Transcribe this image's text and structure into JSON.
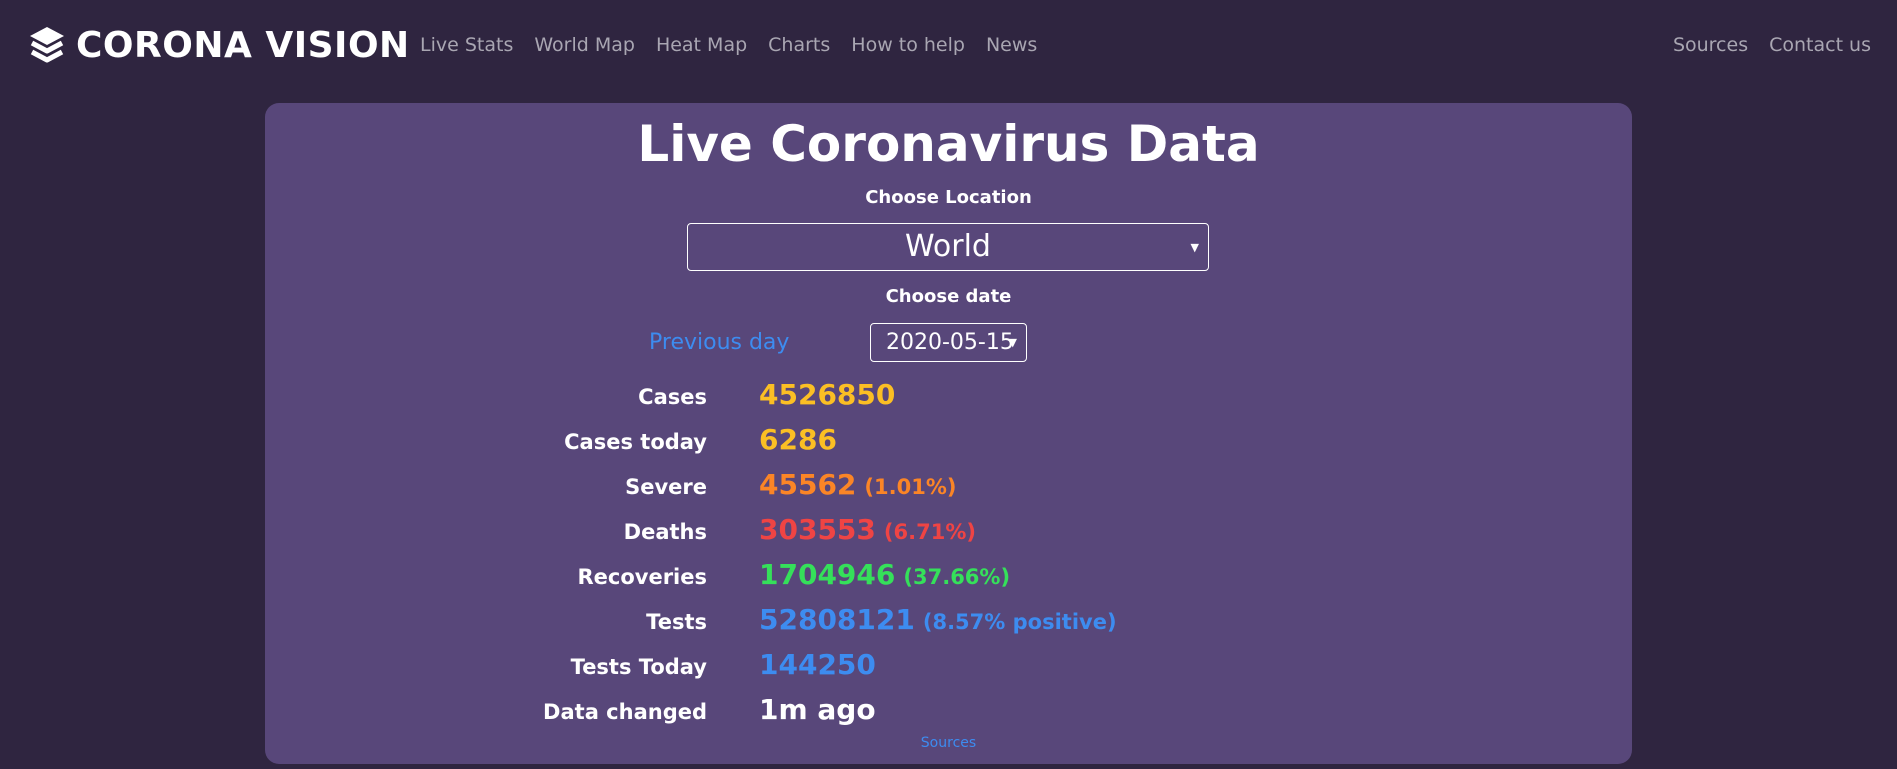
{
  "navbar": {
    "brand": "CORONA VISION",
    "links_left": [
      "Live Stats",
      "World Map",
      "Heat Map",
      "Charts",
      "How to help",
      "News"
    ],
    "links_right": [
      "Sources",
      "Contact us"
    ]
  },
  "main": {
    "title": "Live Coronavirus Data",
    "location_label": "Choose Location",
    "location_value": "World",
    "date_label": "Choose date",
    "previous_day": "Previous day",
    "date_value": "2020-05-15",
    "stats": [
      {
        "label": "Cases",
        "value": "4526850",
        "extra": "",
        "color": "#fbbf24"
      },
      {
        "label": "Cases today",
        "value": "6286",
        "extra": "",
        "color": "#fbbf24"
      },
      {
        "label": "Severe",
        "value": "45562",
        "extra": "(1.01%)",
        "color": "#fb8526"
      },
      {
        "label": "Deaths",
        "value": "303553",
        "extra": "(6.71%)",
        "color": "#ef4444"
      },
      {
        "label": "Recoveries",
        "value": "1704946",
        "extra": "(37.66%)",
        "color": "#35e05a"
      },
      {
        "label": "Tests",
        "value": "52808121",
        "extra": "(8.57% positive)",
        "color": "#3d8cf0"
      },
      {
        "label": "Tests Today",
        "value": "144250",
        "extra": "",
        "color": "#3d8cf0"
      },
      {
        "label": "Data changed",
        "value": "1m ago",
        "extra": "",
        "color": "#ffffff"
      }
    ],
    "sources_link": "Sources"
  },
  "icons": {
    "brand_logo": "layers-stack-icon",
    "select_arrow": "triangle-down-icon"
  },
  "colors": {
    "background": "#2f2540",
    "panel": "#58477a",
    "link": "#3d8cf0",
    "nav_text": "#a9a6b2"
  }
}
